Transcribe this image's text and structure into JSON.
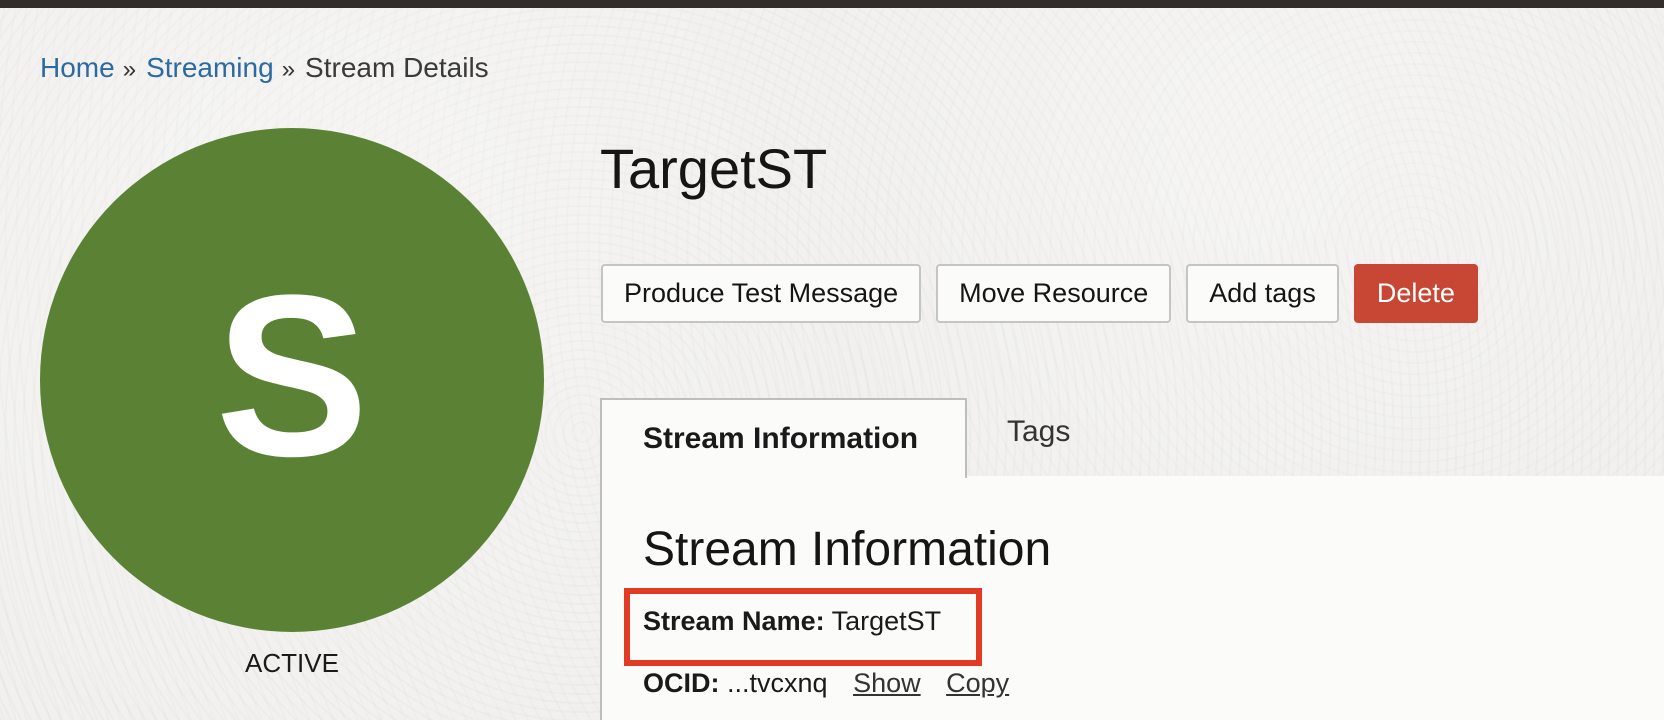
{
  "breadcrumb": {
    "items": [
      {
        "label": "Home"
      },
      {
        "label": "Streaming"
      }
    ],
    "separator": "»",
    "current": "Stream Details"
  },
  "avatar": {
    "letter": "S",
    "color": "#5b8234",
    "status": "ACTIVE"
  },
  "page": {
    "title": "TargetST"
  },
  "actions": {
    "produce_test_message": "Produce Test Message",
    "move_resource": "Move Resource",
    "add_tags": "Add tags",
    "delete": "Delete",
    "delete_color": "#c74634"
  },
  "tabs": [
    {
      "label": "Stream Information",
      "active": true
    },
    {
      "label": "Tags",
      "active": false
    }
  ],
  "stream_info": {
    "heading": "Stream Information",
    "stream_name_label": "Stream Name:",
    "stream_name_value": "TargetST",
    "ocid_label": "OCID:",
    "ocid_value": "...tvcxnq",
    "show_link": "Show",
    "copy_link": "Copy",
    "highlight_color": "#e23b24"
  }
}
